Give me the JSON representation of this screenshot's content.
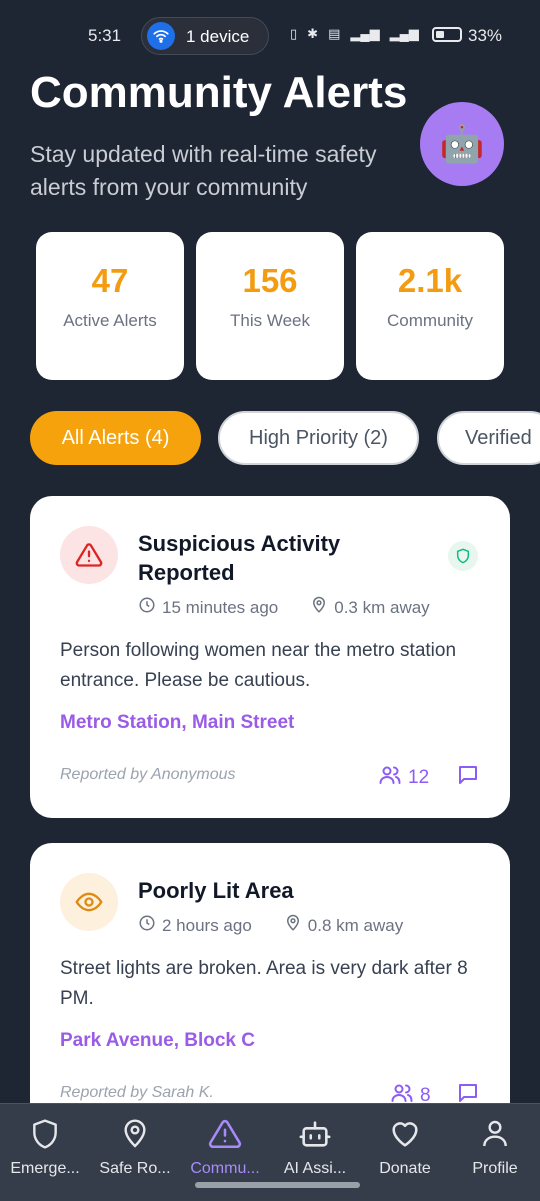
{
  "status_bar": {
    "time": "5:31",
    "device_pill": "1 device",
    "battery": "33%"
  },
  "header": {
    "title": "Community Alerts",
    "subtitle": "Stay updated with real-time safety alerts from your community"
  },
  "stats": [
    {
      "value": "47",
      "label": "Active Alerts"
    },
    {
      "value": "156",
      "label": "This Week"
    },
    {
      "value": "2.1k",
      "label": "Community"
    }
  ],
  "filters": [
    {
      "label": "All Alerts (4)",
      "active": true
    },
    {
      "label": "High Priority (2)",
      "active": false
    },
    {
      "label": "Verified",
      "active": false
    }
  ],
  "alerts": [
    {
      "icon": "warning-triangle-icon",
      "title": "Suspicious Activity Reported",
      "time": "15 minutes ago",
      "distance": "0.3 km away",
      "description": "Person following women near the metro station entrance. Please be cautious.",
      "location": "Metro Station, Main Street",
      "reporter": "Reported by Anonymous",
      "people_count": "12",
      "verified": true
    },
    {
      "icon": "eye-icon",
      "title": "Poorly Lit Area",
      "time": "2 hours ago",
      "distance": "0.8 km away",
      "description": "Street lights are broken. Area is very dark after 8 PM.",
      "location": "Park Avenue, Block C",
      "reporter": "Reported by Sarah K.",
      "people_count": "8",
      "verified": false
    }
  ],
  "bottom_nav": [
    {
      "label": "Emerge...",
      "icon": "shield-icon"
    },
    {
      "label": "Safe Ro...",
      "icon": "map-pin-icon"
    },
    {
      "label": "Commu...",
      "icon": "alert-triangle-icon",
      "active": true
    },
    {
      "label": "AI Assi...",
      "icon": "bot-icon"
    },
    {
      "label": "Donate",
      "icon": "heart-icon"
    },
    {
      "label": "Profile",
      "icon": "user-icon"
    }
  ],
  "colors": {
    "accent": "#f5a20c",
    "purple": "#9a5ce6",
    "background": "#1e2533"
  }
}
